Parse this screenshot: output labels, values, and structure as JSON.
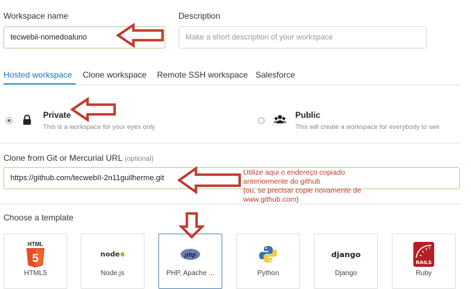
{
  "workspace_name": {
    "label": "Workspace name",
    "value": "tecwebii-nomedoaluno"
  },
  "description": {
    "label": "Description",
    "placeholder": "Make a short description of your workspace"
  },
  "tabs": [
    {
      "label": "Hosted workspace",
      "active": true
    },
    {
      "label": "Clone workspace"
    },
    {
      "label": "Remote SSH workspace"
    },
    {
      "label": "Salesforce"
    }
  ],
  "visibility": {
    "private": {
      "title": "Private",
      "subtitle": "This is a workspace for your eyes only",
      "selected": true,
      "icon": "lock-icon"
    },
    "public": {
      "title": "Public",
      "subtitle": "This will create a workspace for everybody to see",
      "selected": false,
      "icon": "users-icon"
    }
  },
  "clone": {
    "label": "Clone from Git or Mercurial URL",
    "optional": "(optional)",
    "value": "https://github.com/tecwebII-2n11guilherme.git"
  },
  "annotation": {
    "lines": [
      "Utilize aqui o endereço copiado",
      "anteriormente do github",
      "(ou, se precisar copie novamente de",
      "www.github.com)"
    ],
    "color": "#c0392b"
  },
  "template": {
    "label": "Choose a template",
    "items": [
      {
        "name": "HTML5",
        "logo_text": "HTML",
        "badge": "5"
      },
      {
        "name": "Node.js",
        "logo_text": "node"
      },
      {
        "name": "PHP, Apache ...",
        "logo_text": "php",
        "selected": true
      },
      {
        "name": "Python"
      },
      {
        "name": "Django",
        "logo_text": "django"
      },
      {
        "name": "Ruby",
        "logo_text": "RAILS"
      }
    ]
  },
  "colors": {
    "accent": "#3b9ad9",
    "arrow": "#c0392b",
    "selected_border": "#5a8ab5",
    "input_green": "#b5d49a"
  }
}
